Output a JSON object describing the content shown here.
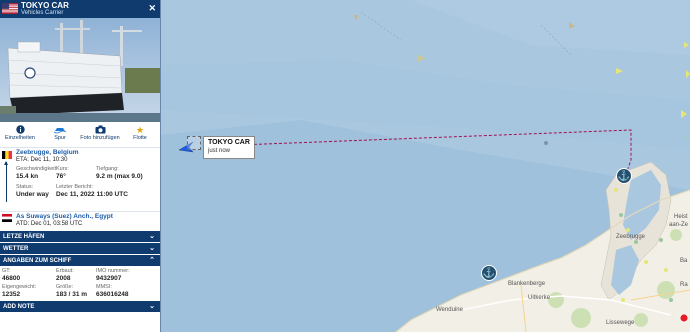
{
  "vessel": {
    "name": "TOKYO CAR",
    "type": "Vehicles Carrier",
    "flag_colors": [
      "#b22234",
      "#ffffff",
      "#3c3b6e"
    ]
  },
  "actions": [
    {
      "icon": "info-icon",
      "label": "Einzelheiten"
    },
    {
      "icon": "track-icon",
      "label": "Spur"
    },
    {
      "icon": "camera-icon",
      "label": "Foto hinzufügen"
    },
    {
      "icon": "star-icon",
      "label": "Flotte"
    }
  ],
  "destination": {
    "port": "Zeebrugge, Belgium",
    "eta": "ETA: Dec 11, 10:30"
  },
  "voyage": {
    "speed_label": "Geschwindigkeit",
    "speed_value": "15.4 kn",
    "course_label": "Kurs:",
    "course_value": "76°",
    "draught_label": "Tiefgang:",
    "draught_value": "9.2 m (max 9.0)",
    "status_label": "Status:",
    "status_value": "Under way",
    "last_report_label": "Letzter Bericht:",
    "last_report_value": "Dec 11, 2022 11:00 UTC"
  },
  "departure": {
    "port": "As Suways (Suez) Anch., Egypt",
    "atd": "ATD: Dec 01, 03:58 UTC"
  },
  "sections": {
    "last_ports": "LETZE HÄFEN",
    "weather": "WETTER",
    "ship_details": "ANGABEN ZUM SCHIFF",
    "add_note": "ADD NOTE"
  },
  "ship_details": {
    "gt_label": "GT:",
    "gt_value": "46800",
    "built_label": "Erbaut:",
    "built_value": "2008",
    "imo_label": "IMO nummer:",
    "imo_value": "9432907",
    "dwt_label": "Eigengewicht:",
    "dwt_value": "12352",
    "size_label": "Größe:",
    "size_value": "183 / 31 m",
    "mmsi_label": "MMSI:",
    "mmsi_value": "636016248"
  },
  "map": {
    "tooltip_name": "TOKYO CAR",
    "tooltip_time": "just now",
    "place_labels": [
      "Zeebrugge",
      "Blankenberge",
      "Uitkerke",
      "Wenduine",
      "Lissewege",
      "Heist",
      "aan-Ze",
      "Ra",
      "Ba"
    ],
    "track_color": "#a01050"
  }
}
